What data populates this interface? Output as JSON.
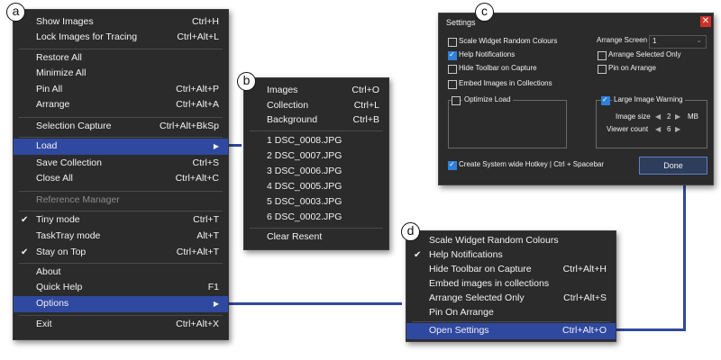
{
  "badges": {
    "a": "a",
    "b": "b",
    "c": "c",
    "d": "d"
  },
  "menu_a": {
    "items": [
      {
        "label": "Show Images",
        "shortcut": "Ctrl+H"
      },
      {
        "label": "Lock Images for Tracing",
        "shortcut": "Ctrl+Alt+L"
      },
      {
        "label": "Restore All",
        "shortcut": ""
      },
      {
        "label": "Minimize All",
        "shortcut": ""
      },
      {
        "label": "Pin All",
        "shortcut": "Ctrl+Alt+P"
      },
      {
        "label": "Arrange",
        "shortcut": "Ctrl+Alt+A"
      },
      {
        "label": "Selection Capture",
        "shortcut": "Ctrl+Alt+BkSp"
      },
      {
        "label": "Load",
        "shortcut": ""
      },
      {
        "label": "Save Collection",
        "shortcut": "Ctrl+S"
      },
      {
        "label": "Close All",
        "shortcut": "Ctrl+Alt+C"
      },
      {
        "label": "Reference Manager",
        "shortcut": ""
      },
      {
        "label": "Tiny mode",
        "shortcut": "Ctrl+T"
      },
      {
        "label": "TaskTray mode",
        "shortcut": "Alt+T"
      },
      {
        "label": "Stay on Top",
        "shortcut": "Ctrl+Alt+T"
      },
      {
        "label": "About",
        "shortcut": ""
      },
      {
        "label": "Quick Help",
        "shortcut": "F1"
      },
      {
        "label": "Options",
        "shortcut": ""
      },
      {
        "label": "Exit",
        "shortcut": "Ctrl+Alt+X"
      }
    ]
  },
  "menu_b": {
    "items": [
      {
        "label": "Images",
        "shortcut": "Ctrl+O"
      },
      {
        "label": "Collection",
        "shortcut": "Ctrl+L"
      },
      {
        "label": "Background",
        "shortcut": "Ctrl+B"
      },
      {
        "label": "1  DSC_0008.JPG",
        "shortcut": ""
      },
      {
        "label": "2  DSC_0007.JPG",
        "shortcut": ""
      },
      {
        "label": "3  DSC_0006.JPG",
        "shortcut": ""
      },
      {
        "label": "4  DSC_0005.JPG",
        "shortcut": ""
      },
      {
        "label": "5  DSC_0003.JPG",
        "shortcut": ""
      },
      {
        "label": "6  DSC_0002.JPG",
        "shortcut": ""
      },
      {
        "label": "Clear Resent",
        "shortcut": ""
      }
    ]
  },
  "menu_d": {
    "items": [
      {
        "label": "Scale Widget Random Colours",
        "shortcut": ""
      },
      {
        "label": "Help Notifications",
        "shortcut": ""
      },
      {
        "label": "Hide Toolbar on Capture",
        "shortcut": "Ctrl+Alt+H"
      },
      {
        "label": "Embed images in collections",
        "shortcut": ""
      },
      {
        "label": "Arrange Selected Only",
        "shortcut": "Ctrl+Alt+S"
      },
      {
        "label": "Pin On Arrange",
        "shortcut": ""
      },
      {
        "label": "Open Settings",
        "shortcut": "Ctrl+Alt+O"
      }
    ]
  },
  "settings": {
    "title": "Settings",
    "scale_widget": "Scale Widget Random Colours",
    "help_notifications": "Help Notifications",
    "hide_toolbar": "Hide Toolbar on Capture",
    "embed_images": "Embed Images in Collections",
    "arrange_screen_label": "Arrange Screen",
    "arrange_screen_value": "1",
    "arrange_selected": "Arrange Selected Only",
    "pin_on_arrange": "Pin on Arrange",
    "optimize_load": "Optimize Load",
    "large_image_warning": "Large Image Warning",
    "image_size_label": "Image size",
    "image_size_value": "2",
    "image_size_unit": "MB",
    "viewer_count_label": "Viewer count",
    "viewer_count_value": "6",
    "hotkey": "Create System wide Hotkey | Ctrl + Spacebar",
    "done": "Done"
  }
}
